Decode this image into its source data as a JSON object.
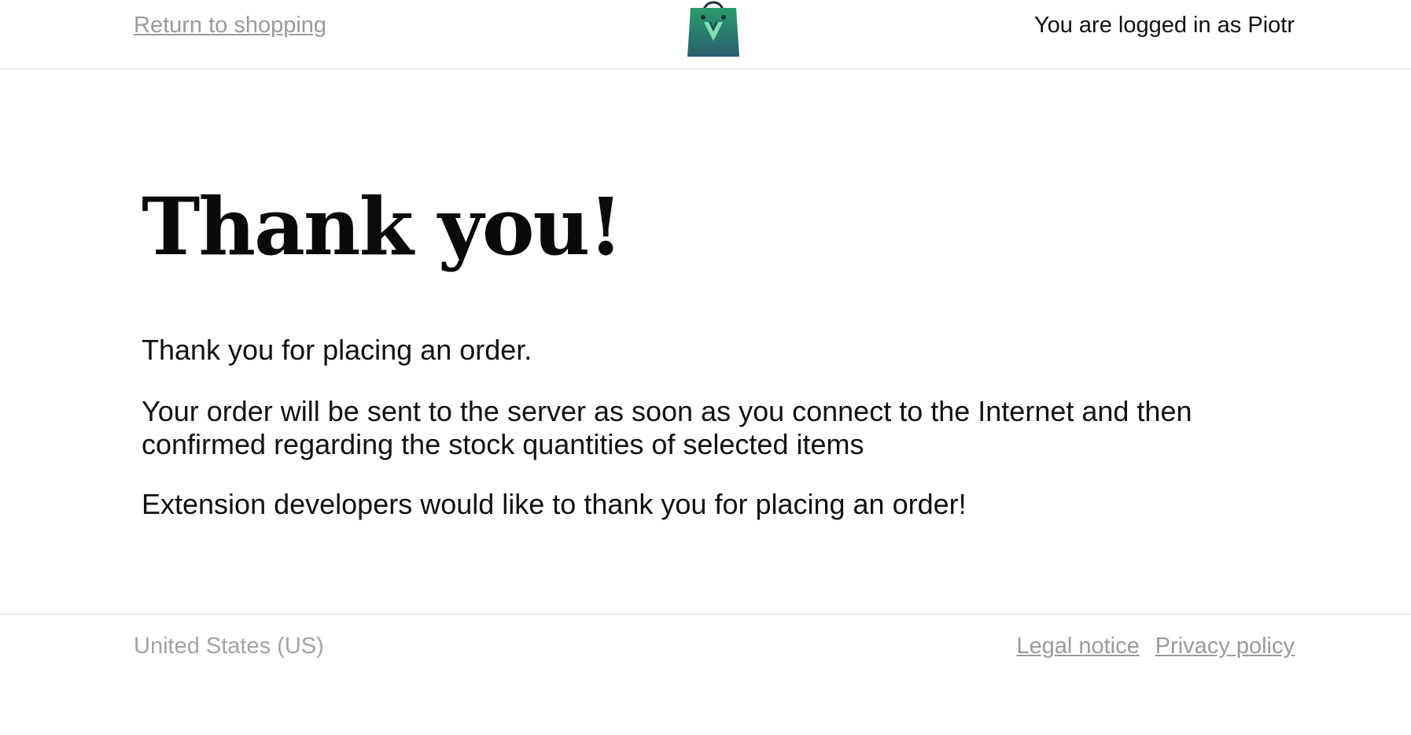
{
  "header": {
    "return_link": "Return to shopping",
    "logo_icon": "shopping-bag-icon",
    "user_status": "You are logged in as Piotr"
  },
  "main": {
    "title": "Thank you!",
    "paragraphs": [
      "Thank you for placing an order.",
      "Your order will be sent to the server as soon as you connect to the Internet and then confirmed regarding the stock quantities of selected items",
      "Extension developers would like to thank you for placing an order!"
    ]
  },
  "footer": {
    "country": "United States (US)",
    "links": [
      "Legal notice",
      "Privacy policy"
    ]
  },
  "colors": {
    "logo_top": "#2a9d6e",
    "logo_bottom": "#2b5f6e",
    "logo_handle": "#1e2f3f",
    "link_gray": "#9a9a9a",
    "divider": "#d6d6d6"
  }
}
